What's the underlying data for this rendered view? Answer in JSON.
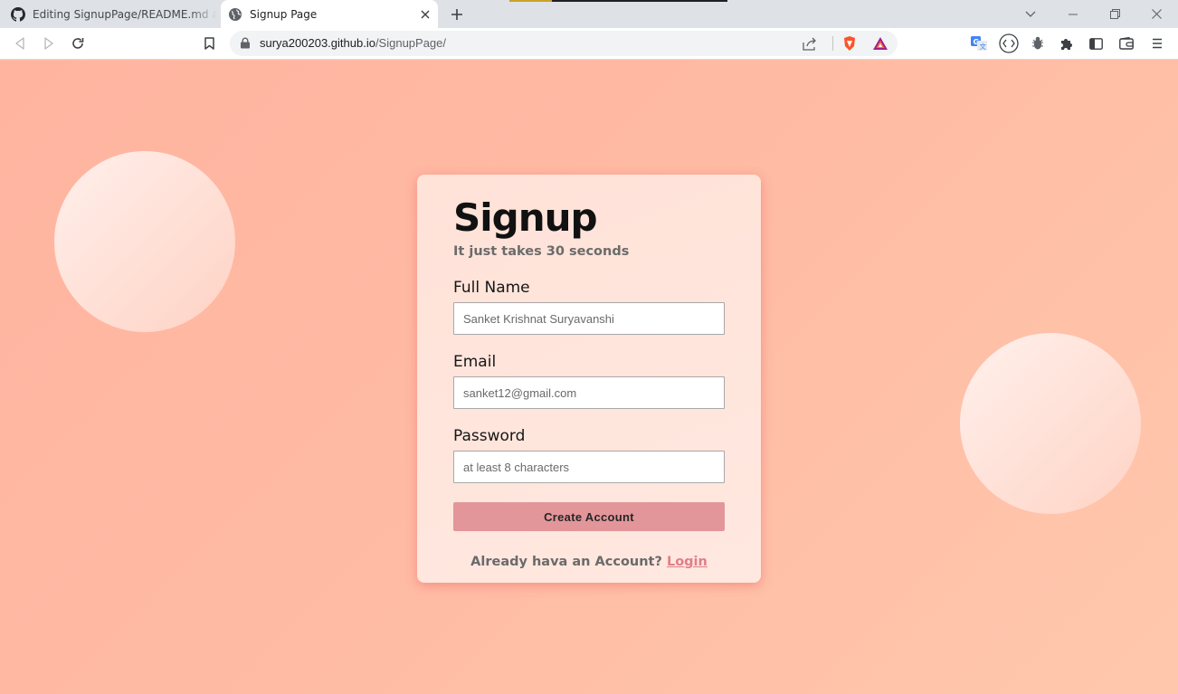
{
  "browser": {
    "tabs": [
      {
        "title": "Editing SignupPage/README.md at main",
        "icon": "github-icon",
        "active": false
      },
      {
        "title": "Signup Page",
        "icon": "globe-icon",
        "active": true
      }
    ],
    "new_tab_icon": "plus-icon",
    "address": {
      "host": "surya200203.github.io",
      "path": "/SignupPage/"
    },
    "extension_icons": [
      "translate-icon",
      "wallet-icon",
      "bug-icon",
      "puzzle-icon",
      "sidebar-icon",
      "brave-wallet-icon",
      "menu-icon"
    ]
  },
  "form": {
    "title": "Signup",
    "subtitle": "It just takes 30 seconds",
    "fields": {
      "name": {
        "label": "Full Name",
        "placeholder": "Sanket Krishnat Suryavanshi"
      },
      "email": {
        "label": "Email",
        "placeholder": "sanket12@gmail.com"
      },
      "password": {
        "label": "Password",
        "placeholder": "at least 8 characters"
      }
    },
    "submit_label": "Create Account",
    "footer_text": "Already hava an Account?",
    "login_link": "Login"
  },
  "colors": {
    "background": "#ffbfa6",
    "card": "#ffe4db",
    "button": "#e3969a",
    "link": "#e07e88"
  }
}
